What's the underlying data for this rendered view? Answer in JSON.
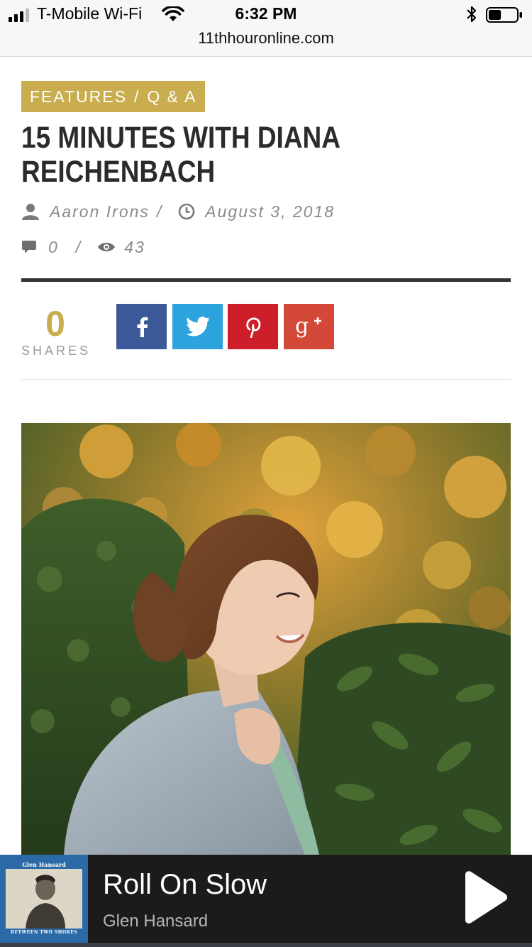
{
  "status_bar": {
    "carrier": "T-Mobile Wi-Fi",
    "time": "6:32 PM",
    "signal_icon": "cellular-signal-icon",
    "wifi_icon": "wifi-icon",
    "bluetooth_icon": "bluetooth-icon",
    "battery_icon": "battery-icon",
    "battery_level": 0.45
  },
  "browser": {
    "url": "11thhouronline.com"
  },
  "article": {
    "category_primary": "FEATURES",
    "category_separator": "/",
    "category_secondary": "Q & A",
    "title": "15 MINUTES WITH DIANA REICHENBACH",
    "author": "Aaron Irons",
    "date": "August 3, 2018",
    "comments": "0",
    "views": "43",
    "separator": "/",
    "colors": {
      "accent": "#c9ad4e",
      "title": "#2b2b2b",
      "meta": "#8a8a8a"
    }
  },
  "share": {
    "count": "0",
    "label": "SHARES",
    "buttons": [
      {
        "network": "facebook",
        "icon": "facebook-icon",
        "color": "#3b5998"
      },
      {
        "network": "twitter",
        "icon": "twitter-icon",
        "color": "#2da3dd"
      },
      {
        "network": "pinterest",
        "icon": "pinterest-icon",
        "color": "#cc1f2a"
      },
      {
        "network": "google-plus",
        "icon": "google-plus-icon",
        "color": "#d34836"
      }
    ]
  },
  "player": {
    "track": "Roll On Slow",
    "artist": "Glen Hansard",
    "album_art_artist": "Glen Hansard",
    "album_art_title": "BETWEEN TWO SHORES",
    "play_icon": "play-icon"
  }
}
